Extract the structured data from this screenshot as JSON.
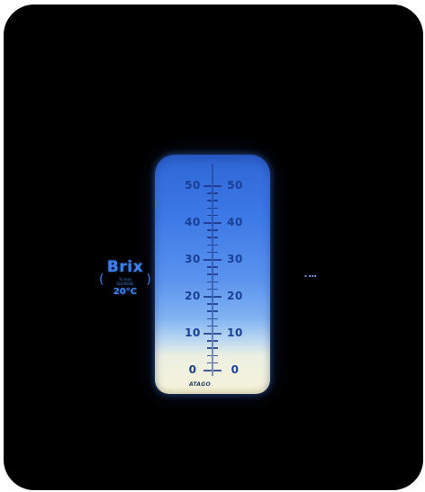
{
  "scale": {
    "left_column": [
      "50",
      "40",
      "30",
      "20",
      "10",
      "0"
    ],
    "right_column": [
      "50",
      "40",
      "30",
      "20",
      "10",
      "0"
    ],
    "brand": "ATAGO"
  },
  "legend": {
    "title": "Brix",
    "line1": "% mas",
    "line2": "SUCROSE",
    "temperature": "20°C"
  },
  "colors": {
    "background": "#000000",
    "scale_top": "#2f67d6",
    "scale_bottom": "#f6f3d8",
    "legend_text": "#3f80ee",
    "scale_numbers": "#1a3f96"
  }
}
